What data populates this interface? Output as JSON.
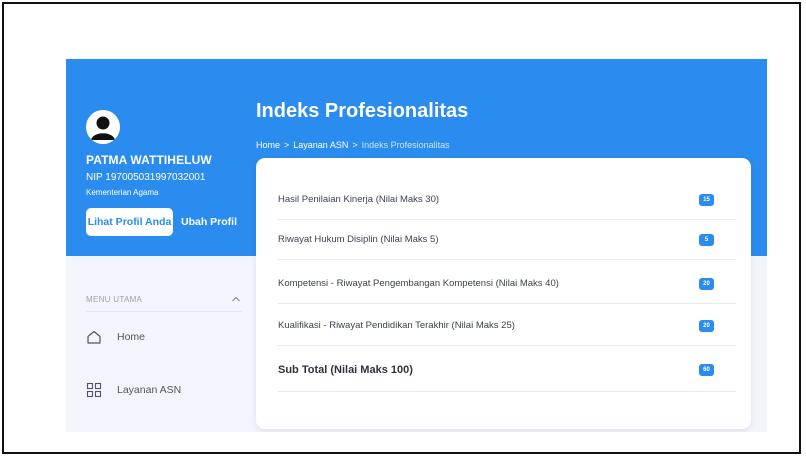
{
  "profile": {
    "name": "PATMA WATTIHELUW",
    "nip": "NIP 197005031997032001",
    "ministry": "Kementerian Agama",
    "view_profile_label": "Lihat Profil Anda",
    "edit_profile_label": "Ubah Profil"
  },
  "menu": {
    "header": "MENU UTAMA",
    "items": [
      {
        "label": "Home",
        "icon": "home-icon"
      },
      {
        "label": "Layanan ASN",
        "icon": "grid-icon"
      }
    ]
  },
  "page": {
    "title": "Indeks Profesionalitas",
    "breadcrumb": [
      "Home",
      "Layanan ASN",
      "Indeks Profesionalitas"
    ],
    "breadcrumb_separator": ">"
  },
  "scores": {
    "rows": [
      {
        "label": "Hasil Penilaian Kinerja (Nilai Maks 30)",
        "value": "15"
      },
      {
        "label": "Riwayat Hukum Disiplin (Nilai Maks 5)",
        "value": "5"
      },
      {
        "label": "Kompetensi - Riwayat Pengembangan Kompetensi (Nilai Maks 40)",
        "value": "20"
      },
      {
        "label": "Kualifikasi - Riwayat Pendidikan Terakhir (Nilai Maks 25)",
        "value": "20"
      }
    ],
    "subtotal": {
      "label": "Sub Total (Nilai Maks 100)",
      "value": "60"
    }
  },
  "colors": {
    "primary": "#2a8cee",
    "background": "#f2f5fb",
    "card": "#ffffff"
  }
}
